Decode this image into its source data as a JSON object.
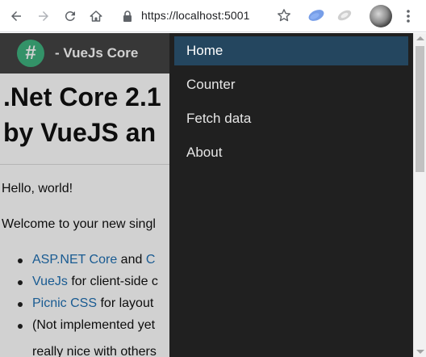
{
  "browser": {
    "url": "https://localhost:5001",
    "icons": [
      "back-arrow-icon",
      "forward-arrow-icon",
      "reload-icon",
      "home-icon",
      "lock-icon",
      "star-icon",
      "extension-icon",
      "extension-icon",
      "profile-avatar",
      "menu-kebab-icon"
    ]
  },
  "header": {
    "logo_symbol": "#",
    "brand": "- VueJs Core",
    "colors": {
      "header_bg": "#444444",
      "logo_bg": "#3fb27f"
    }
  },
  "content": {
    "title_line1": ".Net Core 2.1",
    "title_line2": "by VueJS an",
    "hello": "Hello, world!",
    "welcome": "Welcome to your new singl",
    "list": [
      {
        "link": "ASP.NET Core",
        "text": " and ",
        "link2": "C"
      },
      {
        "link": "VueJs",
        "text": " for client-side c"
      },
      {
        "link": "Picnic CSS",
        "text": " for layout"
      },
      {
        "text": "(Not implemented yet"
      }
    ],
    "overflow_line": "really nice with others"
  },
  "menu": {
    "items": [
      {
        "label": "Home",
        "active": true
      },
      {
        "label": "Counter",
        "active": false
      },
      {
        "label": "Fetch data",
        "active": false
      },
      {
        "label": "About",
        "active": false
      }
    ],
    "colors": {
      "menu_bg": "#202020",
      "active_bg": "#24465f"
    }
  }
}
